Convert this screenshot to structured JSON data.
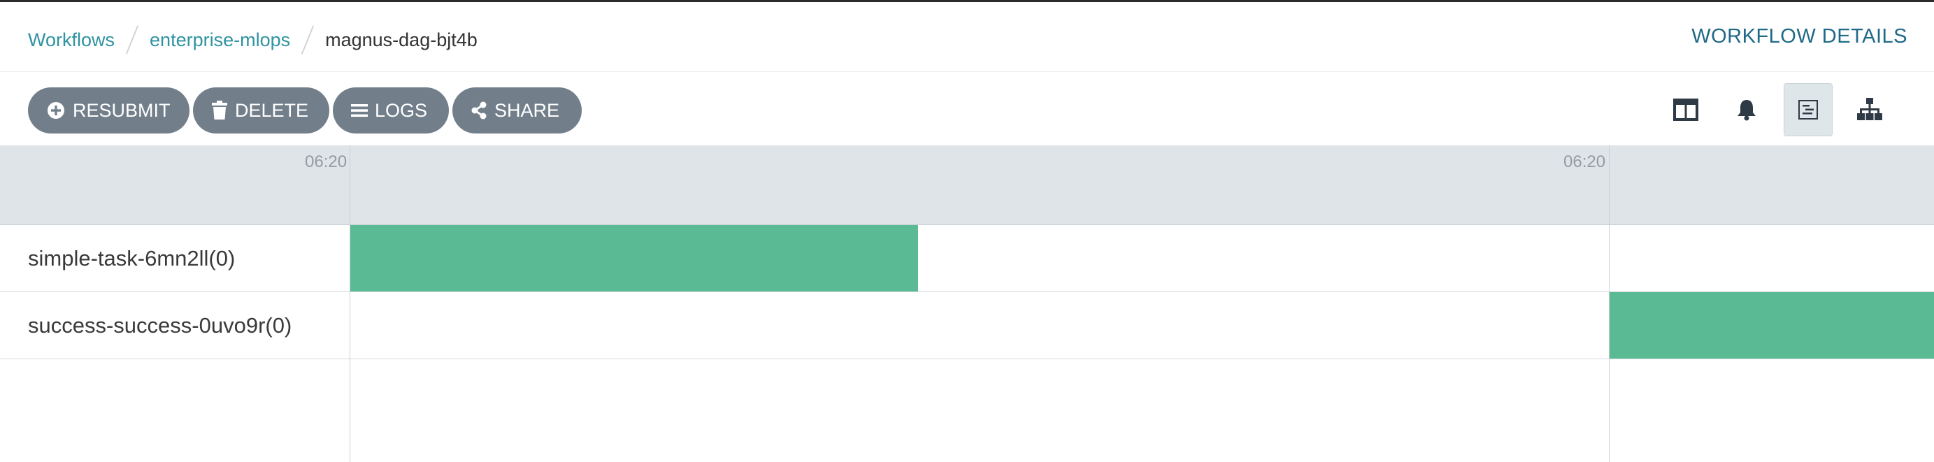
{
  "breadcrumb": {
    "items": [
      {
        "label": "Workflows"
      },
      {
        "label": "enterprise-mlops"
      },
      {
        "label": "magnus-dag-bjt4b"
      }
    ]
  },
  "page_title": "WORKFLOW DETAILS",
  "toolbar": {
    "buttons": [
      {
        "label": "RESUBMIT",
        "icon": "plus-circle-icon"
      },
      {
        "label": "DELETE",
        "icon": "trash-icon"
      },
      {
        "label": "LOGS",
        "icon": "list-icon"
      },
      {
        "label": "SHARE",
        "icon": "share-icon"
      }
    ],
    "view_buttons": [
      {
        "icon": "split-view-icon",
        "active": false
      },
      {
        "icon": "bell-icon",
        "active": false
      },
      {
        "icon": "timeline-icon",
        "active": true
      },
      {
        "icon": "tree-icon",
        "active": false
      }
    ]
  },
  "timeline": {
    "ticks": [
      "06:20",
      "06:20"
    ],
    "rows": [
      {
        "label": "simple-task-6mn2ll(0)"
      },
      {
        "label": "success-success-0uvo9r(0)"
      }
    ]
  },
  "colors": {
    "link": "#2f93a1",
    "title": "#1f6a87",
    "button_bg": "#727f8b",
    "bar": "#5aba94",
    "header_bg": "#dee4e8"
  }
}
